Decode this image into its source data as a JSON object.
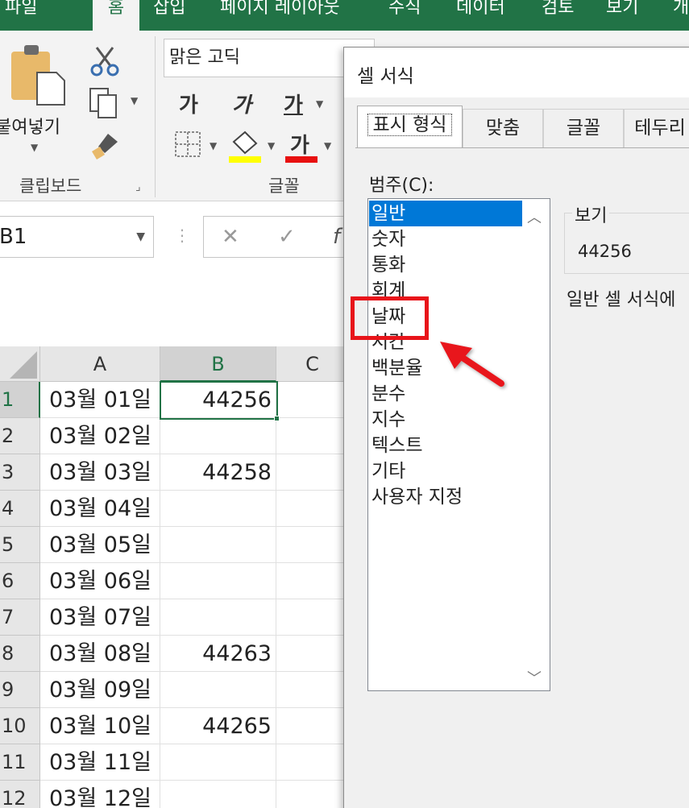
{
  "ribbon_tabs": [
    "파일",
    "홈",
    "삽입",
    "페이지 레이아웃",
    "수식",
    "데이터",
    "검토",
    "보기",
    "개"
  ],
  "ribbon": {
    "paste_label": "붙여넣기",
    "clipboard_group": "클립보드",
    "font_group": "글꼴",
    "font_name": "맑은 고딕",
    "bold": "가",
    "italic": "가",
    "underline": "가",
    "font_color_glyph": "가",
    "highlight_color": "#ffff00",
    "font_color": "#ff0000"
  },
  "formula_bar": {
    "name_box": "B1",
    "cancel": "✕",
    "enter": "✓",
    "fx": "f"
  },
  "grid": {
    "columns": [
      "A",
      "B",
      "C"
    ],
    "rows": [
      {
        "n": "1",
        "a": "03월 01일",
        "b": "44256"
      },
      {
        "n": "2",
        "a": "03월 02일",
        "b": ""
      },
      {
        "n": "3",
        "a": "03월 03일",
        "b": "44258"
      },
      {
        "n": "4",
        "a": "03월 04일",
        "b": ""
      },
      {
        "n": "5",
        "a": "03월 05일",
        "b": ""
      },
      {
        "n": "6",
        "a": "03월 06일",
        "b": ""
      },
      {
        "n": "7",
        "a": "03월 07일",
        "b": ""
      },
      {
        "n": "8",
        "a": "03월 08일",
        "b": "44263"
      },
      {
        "n": "9",
        "a": "03월 09일",
        "b": ""
      },
      {
        "n": "10",
        "a": "03월 10일",
        "b": "44265"
      },
      {
        "n": "11",
        "a": "03월 11일",
        "b": ""
      },
      {
        "n": "12",
        "a": "03월 12일",
        "b": ""
      }
    ]
  },
  "dialog": {
    "title": "셀 서식",
    "tabs": [
      "표시 형식",
      "맞춤",
      "글꼴",
      "테두리"
    ],
    "category_label": "범주(C):",
    "categories": [
      "일반",
      "숫자",
      "통화",
      "회계",
      "날짜",
      "시간",
      "백분율",
      "분수",
      "지수",
      "텍스트",
      "기타",
      "사용자 지정"
    ],
    "selected_category": "일반",
    "highlighted_category": "날짜",
    "sample_label": "보기",
    "sample_value": "44256",
    "description": "일반 셀 서식에"
  }
}
